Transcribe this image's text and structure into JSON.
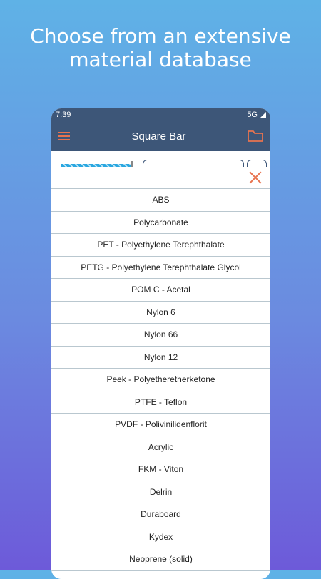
{
  "headline": [
    "Choose from an extensive",
    "material database"
  ],
  "status_bar": {
    "time": "7:39",
    "network": "5G"
  },
  "app_bar": {
    "title": "Square Bar",
    "menu_icon": "hamburger-menu-icon",
    "folder_icon": "folder-icon"
  },
  "colors": {
    "appbar": "#3d5678",
    "accent": "#e8734f",
    "divider": "#b9c7cf"
  },
  "materials": [
    "ABS",
    "Polycarbonate",
    "PET - Polyethylene Terephthalate",
    "PETG - Polyethylene Terephthalate Glycol",
    "POM C - Acetal",
    "Nylon 6",
    "Nylon 66",
    "Nylon 12",
    "Peek - Polyetheretherketone",
    "PTFE - Teflon",
    "PVDF - Polivinilidenflorit",
    "Acrylic",
    "FKM - Viton",
    "Delrin",
    "Duraboard",
    "Kydex",
    "Neoprene (solid)"
  ]
}
